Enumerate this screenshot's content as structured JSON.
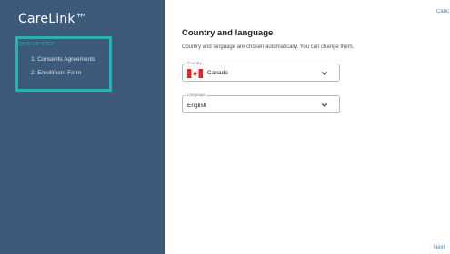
{
  "sidebar": {
    "brand": "CareLink™",
    "steps_heading": "SIGN UP STEP",
    "steps": [
      {
        "label": "1. Consents Agreements"
      },
      {
        "label": "2. Enrollment Form"
      }
    ]
  },
  "main": {
    "cancel_label": "Canc",
    "title": "Country and language",
    "subtitle": "Country and language are chosen automatically. You can change them.",
    "country": {
      "label": "Country",
      "value": "Canada",
      "flag_icon": "canada-flag-icon"
    },
    "language": {
      "label": "Language",
      "value": "English"
    },
    "next_label": "Next"
  },
  "colors": {
    "sidebar_bg": "#3d5a7a",
    "accent_teal": "#1bb7b5",
    "link_blue": "#3a85c7",
    "flag_red": "#e02626"
  }
}
